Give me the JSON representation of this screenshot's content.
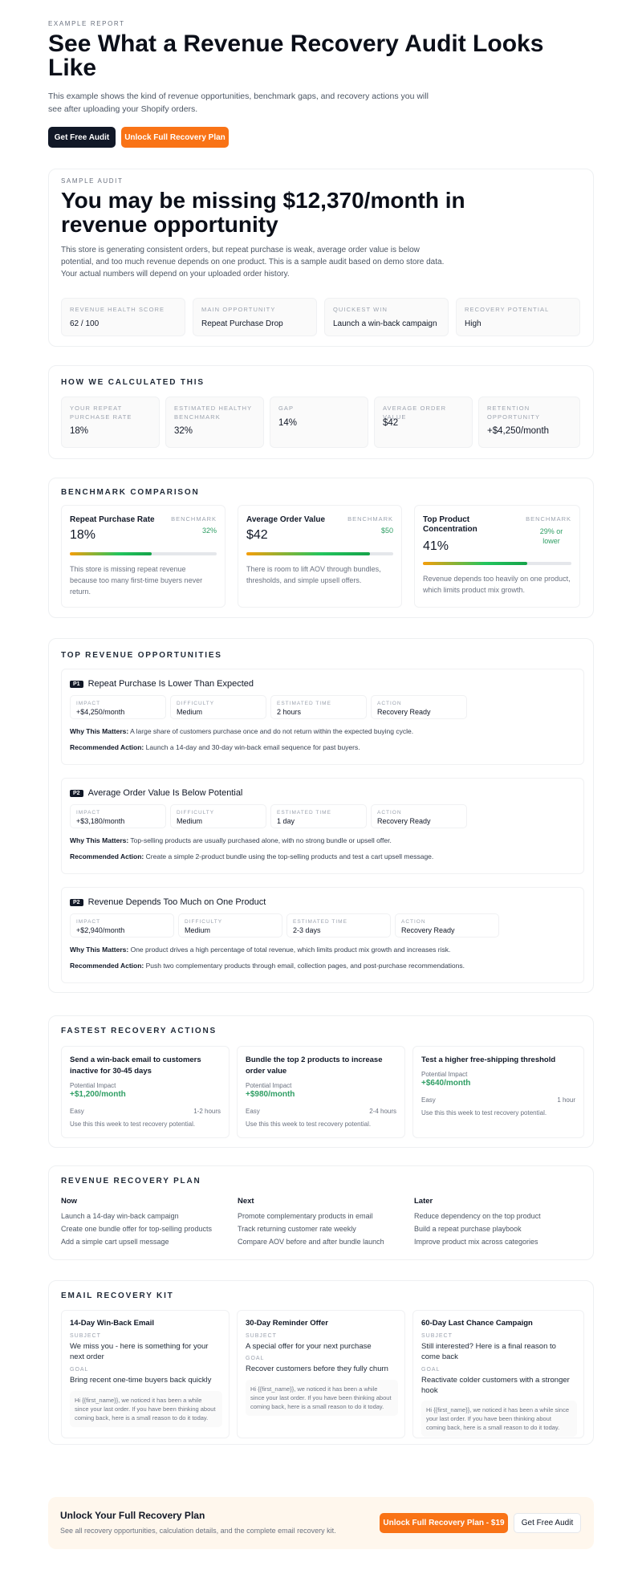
{
  "header": {
    "eyebrow": "EXAMPLE REPORT",
    "title": "See What a Revenue Recovery Audit Looks Like",
    "subtitle": "This example shows the kind of revenue opportunities, benchmark gaps, and recovery actions you will see after uploading your Shopify orders.",
    "btn_free": "Get Free Audit",
    "btn_unlock": "Unlock Full Recovery Plan"
  },
  "hero": {
    "eyebrow": "SAMPLE AUDIT",
    "headline": "You may be missing $12,370/month in revenue opportunity",
    "desc": "This store is generating consistent orders, but repeat purchase is weak, average order value is below potential, and too much revenue depends on one product. This is a sample audit based on demo store data. Your actual numbers will depend on your uploaded order history.",
    "stats": [
      {
        "label": "REVENUE HEALTH SCORE",
        "value": "62 / 100"
      },
      {
        "label": "MAIN OPPORTUNITY",
        "value": "Repeat Purchase Drop"
      },
      {
        "label": "QUICKEST WIN",
        "value": "Launch a win-back campaign"
      },
      {
        "label": "RECOVERY POTENTIAL",
        "value": "High"
      }
    ]
  },
  "calc": {
    "title": "HOW WE CALCULATED THIS",
    "items": [
      {
        "label": "YOUR REPEAT PURCHASE RATE",
        "value": "18%"
      },
      {
        "label": "ESTIMATED HEALTHY BENCHMARK",
        "value": "32%"
      },
      {
        "label": "GAP",
        "value": "14%"
      },
      {
        "label": "AVERAGE ORDER VALUE",
        "value": "$42"
      },
      {
        "label": "RETENTION OPPORTUNITY",
        "value": "+$4,250/month"
      }
    ]
  },
  "bench": {
    "title": "BENCHMARK COMPARISON",
    "bench_label": "BENCHMARK",
    "items": [
      {
        "name": "Repeat Purchase Rate",
        "value": "18%",
        "bench": "32%",
        "fill": 0.56,
        "note": "This store is missing repeat revenue because too many first-time buyers never return."
      },
      {
        "name": "Average Order Value",
        "value": "$42",
        "bench": "$50",
        "fill": 0.84,
        "note": "There is room to lift AOV through bundles, thresholds, and simple upsell offers."
      },
      {
        "name": "Top Product Concentration",
        "value": "41%",
        "bench": "29% or lower",
        "fill": 0.7,
        "note": "Revenue depends too heavily on one product, which limits product mix growth."
      }
    ]
  },
  "opps": {
    "title": "TOP REVENUE OPPORTUNITIES",
    "labels": {
      "impact": "IMPACT",
      "difficulty": "DIFFICULTY",
      "time": "ESTIMATED TIME",
      "action": "ACTION",
      "why": "Why This Matters:",
      "rec": "Recommended Action:"
    },
    "items": [
      {
        "tag": "P1",
        "title": "Repeat Purchase Is Lower Than Expected",
        "impact": "+$4,250/month",
        "difficulty": "Medium",
        "time": "2 hours",
        "action": "Recovery Ready",
        "why": "A large share of customers purchase once and do not return within the expected buying cycle.",
        "rec": "Launch a 14-day and 30-day win-back email sequence for past buyers."
      },
      {
        "tag": "P2",
        "title": "Average Order Value Is Below Potential",
        "impact": "+$3,180/month",
        "difficulty": "Medium",
        "time": "1 day",
        "action": "Recovery Ready",
        "why": "Top-selling products are usually purchased alone, with no strong bundle or upsell offer.",
        "rec": "Create a simple 2-product bundle using the top-selling products and test a cart upsell message."
      },
      {
        "tag": "P2",
        "title": "Revenue Depends Too Much on One Product",
        "impact": "+$2,940/month",
        "difficulty": "Medium",
        "time": "2-3 days",
        "action": "Recovery Ready",
        "why": "One product drives a high percentage of total revenue, which limits product mix growth and increases risk.",
        "rec": "Push two complementary products through email, collection pages, and post-purchase recommendations."
      }
    ]
  },
  "fast": {
    "title": "FASTEST RECOVERY ACTIONS",
    "impact_label": "Potential Impact",
    "items": [
      {
        "title": "Send a win-back email to customers inactive for 30-45 days",
        "impact": "+$1,200/month",
        "ease": "Easy",
        "time": "1-2 hours",
        "note": "Use this this week to test recovery potential."
      },
      {
        "title": "Bundle the top 2 products to increase order value",
        "impact": "+$980/month",
        "ease": "Easy",
        "time": "2-4 hours",
        "note": "Use this this week to test recovery potential."
      },
      {
        "title": "Test a higher free-shipping threshold",
        "impact": "+$640/month",
        "ease": "Easy",
        "time": "1 hour",
        "note": "Use this this week to test recovery potential."
      }
    ]
  },
  "plan": {
    "title": "REVENUE RECOVERY PLAN",
    "cols": [
      {
        "name": "Now",
        "items": [
          "Launch a 14-day win-back campaign",
          "Create one bundle offer for top-selling products",
          "Add a simple cart upsell message"
        ]
      },
      {
        "name": "Next",
        "items": [
          "Promote complementary products in email",
          "Track returning customer rate weekly",
          "Compare AOV before and after bundle launch"
        ]
      },
      {
        "name": "Later",
        "items": [
          "Reduce dependency on the top product",
          "Build a repeat purchase playbook",
          "Improve product mix across categories"
        ]
      }
    ]
  },
  "kit": {
    "title": "EMAIL RECOVERY KIT",
    "subject_label": "SUBJECT",
    "goal_label": "GOAL",
    "items": [
      {
        "name": "14-Day Win-Back Email",
        "subject": "We miss you - here is something for your next order",
        "goal": "Bring recent one-time buyers back quickly",
        "body": "Hi {{first_name}}, we noticed it has been a while since your last order. If you have been thinking about coming back, here is a small reason to do it today."
      },
      {
        "name": "30-Day Reminder Offer",
        "subject": "A special offer for your next purchase",
        "goal": "Recover customers before they fully churn",
        "body": "Hi {{first_name}}, we noticed it has been a while since your last order. If you have been thinking about coming back, here is a small reason to do it today."
      },
      {
        "name": "60-Day Last Chance Campaign",
        "subject": "Still interested? Here is a final reason to come back",
        "goal": "Reactivate colder customers with a stronger hook",
        "body": "Hi {{first_name}}, we noticed it has been a while since your last order. If you have been thinking about coming back, here is a small reason to do it today."
      }
    ]
  },
  "cta": {
    "title": "Unlock Your Full Recovery Plan",
    "desc": "See all recovery opportunities, calculation details, and the complete email recovery kit.",
    "btn_unlock": "Unlock Full Recovery Plan - $19",
    "btn_free": "Get Free Audit"
  },
  "colors": {
    "accent": "#f97316",
    "dark": "#111827",
    "positive": "#2f9e64",
    "cta_bg": "#fff7ed"
  }
}
